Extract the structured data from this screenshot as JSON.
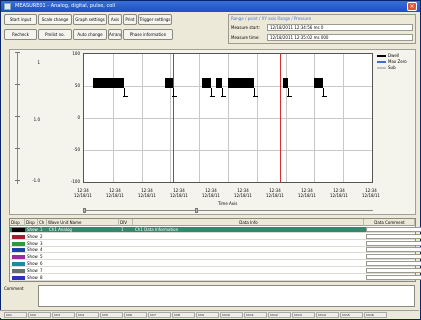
{
  "window": {
    "title": "MEASURE01 - Analog, digital, pulse, coil"
  },
  "toolbar": {
    "row1": [
      "Start input",
      "Scale change",
      "Graph settings",
      "Axis",
      "Print",
      "Trigger settings"
    ],
    "row2": [
      "Recheck",
      "Prelist no.",
      "Auto change",
      "Arrange",
      "Phase information"
    ]
  },
  "info_panel": {
    "header": "Range / point / XY axis Range / Pressure",
    "rows": [
      {
        "label": "Measure start:",
        "value": "12/18/2011 12:34:56 ms 0"
      },
      {
        "label": "Measure time:",
        "value": "12/18/2011 12:35:02 ms 000"
      }
    ]
  },
  "chart_data": {
    "type": "line",
    "y_ticks": [
      "100",
      "50",
      "0",
      "-50",
      "-100"
    ],
    "y_slider_ticks": [
      "1",
      "1.0",
      "-1.0"
    ],
    "x_ticks": [
      "12:34\n12/18/11",
      "12:34\n12/18/11",
      "12:34\n12/18/11",
      "12:34\n12/18/11",
      "12:34\n12/18/11",
      "12:34\n12/18/11",
      "12:34\n12/18/11",
      "12:34\n12/18/11",
      "12:34\n12/18/11",
      "12:34\n12/18/11"
    ],
    "xlabel": "Time Axis",
    "grid": true,
    "legend": [
      {
        "name": "Dwell",
        "color": "#000000"
      },
      {
        "name": "Max Zero",
        "color": "#3a6fd8"
      },
      {
        "name": "Sub",
        "color": "#c0c0c0"
      }
    ],
    "markers": [
      0.31,
      0.68
    ],
    "pulses": [
      {
        "start": 0.03,
        "end": 0.14
      },
      {
        "start": 0.28,
        "end": 0.31
      },
      {
        "start": 0.41,
        "end": 0.44
      },
      {
        "start": 0.46,
        "end": 0.48
      },
      {
        "start": 0.5,
        "end": 0.59
      },
      {
        "start": 0.69,
        "end": 0.71
      },
      {
        "start": 0.8,
        "end": 0.83
      }
    ],
    "level": 50
  },
  "table": {
    "headers": [
      "Disp",
      "Disp",
      "Ch",
      "Wave Unit Name",
      "DIV",
      "Data Info",
      "Data Comment"
    ],
    "rows": [
      {
        "color": "#000000",
        "disp": "Show",
        "ch": "1",
        "name": "Ch1 Analog",
        "div": "1",
        "info": "Ch1 Data Information",
        "selected": true
      },
      {
        "color": "#a02030",
        "disp": "Show",
        "ch": "2",
        "name": "",
        "div": "",
        "info": "",
        "selected": false
      },
      {
        "color": "#2e9c3c",
        "disp": "Show",
        "ch": "3",
        "name": "",
        "div": "",
        "info": "",
        "selected": false
      },
      {
        "color": "#2040b0",
        "disp": "Show",
        "ch": "4",
        "name": "",
        "div": "",
        "info": "",
        "selected": false
      },
      {
        "color": "#9a2ca0",
        "disp": "Show",
        "ch": "5",
        "name": "",
        "div": "",
        "info": "",
        "selected": false
      },
      {
        "color": "#1c8c9c",
        "disp": "Show",
        "ch": "6",
        "name": "",
        "div": "",
        "info": "",
        "selected": false
      },
      {
        "color": "#6c6c6c",
        "disp": "Show",
        "ch": "7",
        "name": "",
        "div": "",
        "info": "",
        "selected": false
      },
      {
        "color": "#3030c0",
        "disp": "Show",
        "ch": "8",
        "name": "",
        "div": "",
        "info": "",
        "selected": false
      }
    ]
  },
  "comment": {
    "label": "Comment",
    "value": ""
  },
  "statusbar": {
    "tabs": [
      "Ch1",
      "Ch2",
      "Ch3",
      "Ch4",
      "Ch5",
      "Ch6",
      "Ch7",
      "Ch8",
      "Ch9",
      "Ch10",
      "Ch11",
      "Ch12",
      "Ch13",
      "Ch14",
      "Ch15",
      "Ch16"
    ]
  }
}
